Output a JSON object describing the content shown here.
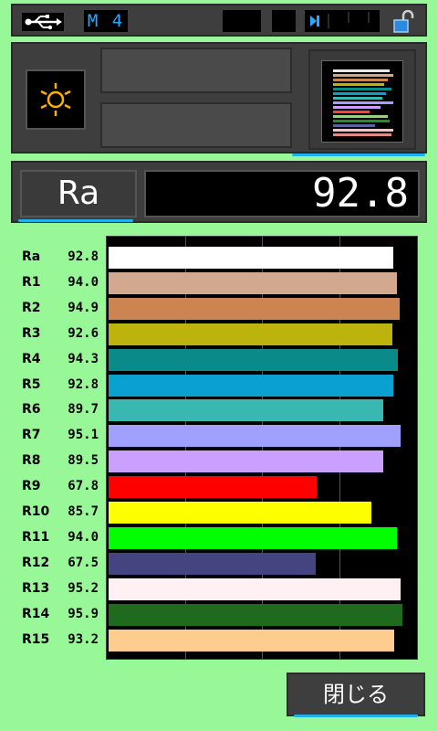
{
  "statusbar": {
    "mode": "M 4"
  },
  "ra": {
    "label": "Ra",
    "value": "92.8"
  },
  "close_button": {
    "label": "閉じる"
  },
  "colors": {
    "background": "#98f898",
    "panel": "#3e3e3e",
    "accent": "#20b0f0",
    "sun_icon": "#ffb000"
  },
  "chart_data": {
    "type": "bar",
    "orientation": "horizontal",
    "categories": [
      "Ra",
      "R1",
      "R2",
      "R3",
      "R4",
      "R5",
      "R6",
      "R7",
      "R8",
      "R9",
      "R10",
      "R11",
      "R12",
      "R13",
      "R14",
      "R15"
    ],
    "values": [
      92.8,
      94.0,
      94.9,
      92.6,
      94.3,
      92.8,
      89.7,
      95.1,
      89.5,
      67.8,
      85.7,
      94.0,
      67.5,
      95.2,
      95.9,
      93.2
    ],
    "value_labels": [
      "92.8",
      "94.0",
      "94.9",
      "92.6",
      "94.3",
      "92.8",
      "89.7",
      "95.1",
      "89.5",
      "67.8",
      "85.7",
      "94.0",
      "67.5",
      "95.2",
      "95.9",
      "93.2"
    ],
    "colors": [
      "#ffffff",
      "#d2a88e",
      "#cc8450",
      "#bcb40c",
      "#0a8a88",
      "#0aa0d0",
      "#38b8b0",
      "#a0a0ff",
      "#caa0ff",
      "#ff0000",
      "#ffff00",
      "#00ff00",
      "#444480",
      "#fff0f4",
      "#206a20",
      "#ffcc90"
    ],
    "xlim": [
      0,
      100
    ],
    "grid": true,
    "title": "",
    "xlabel": "",
    "ylabel": ""
  }
}
